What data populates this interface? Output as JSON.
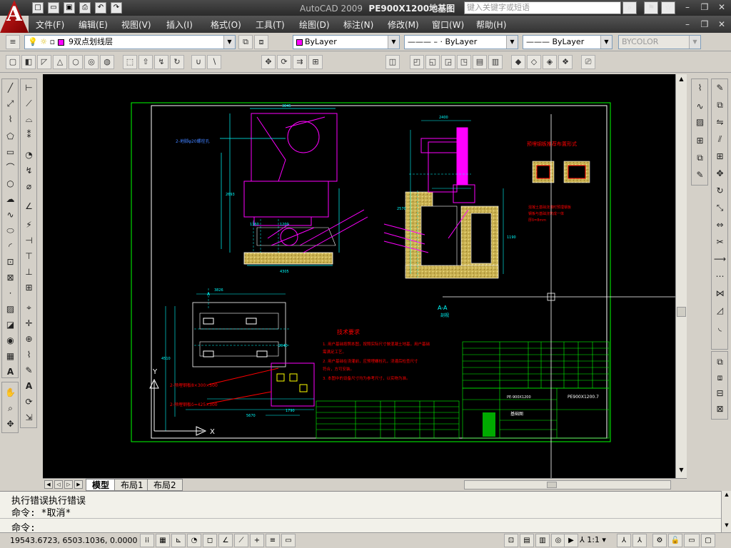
{
  "window": {
    "app_name": "AutoCAD 2009",
    "file_name": "PE900X1200地基图",
    "search_placeholder": "键入关键字或短语"
  },
  "menu": [
    "文件(F)",
    "编辑(E)",
    "视图(V)",
    "插入(I)",
    "格式(O)",
    "工具(T)",
    "绘图(D)",
    "标注(N)",
    "修改(M)",
    "窗口(W)",
    "帮助(H)"
  ],
  "layers_toolbar": {
    "current_layer": "9双点划线层",
    "color": "ByLayer",
    "linetype": "ByLayer",
    "lineweight": "ByLayer",
    "plotstyle": "BYCOLOR",
    "layer_color_hex": "#ff00ff"
  },
  "drawing": {
    "section_label": "A-A",
    "section_sub": "剖视",
    "tech_title": "技术要求",
    "tech_lines": [
      "1. 用户基础按照本图，按照实际尺寸做混凝土地基，用户基础",
      "   需满足工艺。",
      "2. 用户基础在浇灌前，应预埋螺栓孔，浇灌后检查尺寸",
      "   符合，方可安装。",
      "3. 本图中的设备尺寸均为参考尺寸，以实物为准。"
    ],
    "right_note_title": "预埋钢板推荐布置形式",
    "right_note_lines": [
      "混凝土基础浇灌时预埋钢板",
      "钢板与基础浇筑成一体",
      "厚δ=8mm"
    ],
    "anchor_label_1": "2-预埋钢板8×300×500",
    "anchor_label_2": "2-预埋钢板δ=425×300",
    "left_note": "2-地脚φ20螺栓孔",
    "title_block": {
      "model": "PE-900X1200",
      "drawing_no": "PE900X1200.7",
      "name": "基础图"
    },
    "dims": [
      "3845",
      "2693",
      "1360",
      "1200",
      "4305",
      "2400",
      "2570",
      "1190",
      "4510",
      "3826",
      "2040",
      "2650",
      "5670",
      "1790",
      "4950",
      "2400"
    ],
    "ucs_x": "X",
    "ucs_y": "Y",
    "section_marker": "A"
  },
  "tabs": [
    "模型",
    "布局1",
    "布局2"
  ],
  "active_tab": "模型",
  "command": {
    "line1": "执行错误执行错误",
    "line2": "命令: *取消*",
    "prompt": "命令:"
  },
  "status": {
    "coords": "19543.6723, 6503.1036, 0.0000",
    "scale": "1:1"
  },
  "colors": {
    "background": "#000000",
    "border": "#00ff00",
    "dims": "#00ffff",
    "magenta": "#ff00ff",
    "red": "#ff0000",
    "hatch": "#d8c060"
  }
}
